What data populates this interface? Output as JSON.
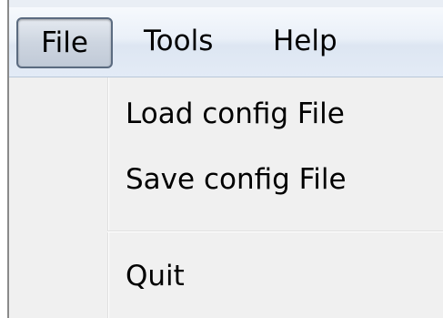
{
  "menubar": {
    "items": [
      {
        "label": "File",
        "state": "open"
      },
      {
        "label": "Tools"
      },
      {
        "label": "Help"
      }
    ]
  },
  "file_menu": {
    "items": [
      {
        "label": "Load config File"
      },
      {
        "label": "Save config File"
      },
      {
        "type": "separator"
      },
      {
        "label": "Quit"
      }
    ]
  },
  "colors": {
    "menubar_gradient_top": "#f6f9fd",
    "menubar_gradient_bottom": "#dde6f2",
    "active_item_border": "#5b6b80",
    "dropdown_background": "#f0f0f0",
    "text": "#000000"
  }
}
